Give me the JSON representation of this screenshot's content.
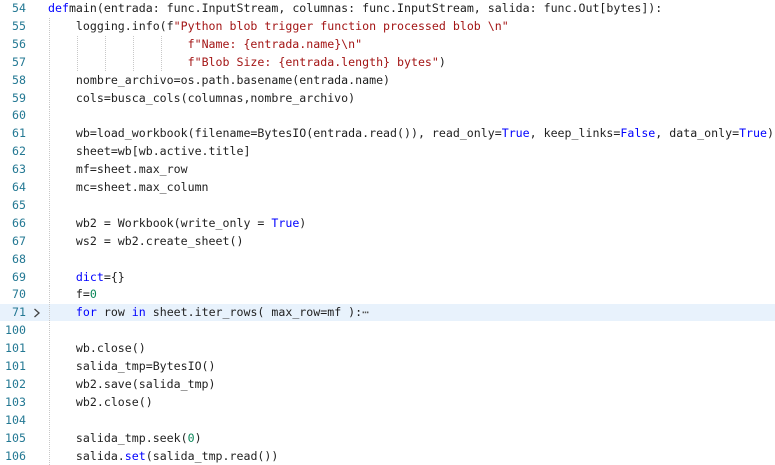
{
  "editor": {
    "lines": [
      {
        "num": "54",
        "indent": 0,
        "tokens": [
          [
            "kw",
            "def"
          ],
          [
            "",
            "main(entrada: func.InputStream, columnas: func.InputStream, salida: func.Out[bytes]):"
          ]
        ]
      },
      {
        "num": "55",
        "indent": 1,
        "tokens": [
          [
            "",
            "logging.info(f"
          ],
          [
            "str",
            "\"Python blob trigger function processed blob \\n\""
          ]
        ]
      },
      {
        "num": "56",
        "indent": 1,
        "extra_guides": 4,
        "tokens": [
          [
            "",
            "                "
          ],
          [
            "str",
            "f\"Name: {entrada.name}\\n\""
          ]
        ]
      },
      {
        "num": "57",
        "indent": 1,
        "extra_guides": 4,
        "tokens": [
          [
            "",
            "                "
          ],
          [
            "str",
            "f\"Blob Size: {entrada.length} bytes\""
          ],
          [
            "",
            ")"
          ]
        ]
      },
      {
        "num": "58",
        "indent": 1,
        "tokens": [
          [
            "",
            "nombre_archivo=os.path.basename(entrada.name)"
          ]
        ]
      },
      {
        "num": "59",
        "indent": 1,
        "tokens": [
          [
            "",
            "cols=busca_cols(columnas,nombre_archivo)"
          ]
        ]
      },
      {
        "num": "60",
        "indent": 1,
        "tokens": []
      },
      {
        "num": "61",
        "indent": 1,
        "tokens": [
          [
            "",
            "wb=load_workbook(filename=BytesIO(entrada.read()), read_only="
          ],
          [
            "kw",
            "True"
          ],
          [
            "",
            ", keep_links="
          ],
          [
            "kw",
            "False"
          ],
          [
            "",
            ", data_only="
          ],
          [
            "kw",
            "True"
          ],
          [
            "",
            ")"
          ]
        ]
      },
      {
        "num": "62",
        "indent": 1,
        "tokens": [
          [
            "",
            "sheet=wb[wb.active.title]"
          ]
        ]
      },
      {
        "num": "63",
        "indent": 1,
        "tokens": [
          [
            "",
            "mf=sheet.max_row"
          ]
        ]
      },
      {
        "num": "64",
        "indent": 1,
        "tokens": [
          [
            "",
            "mc=sheet.max_column"
          ]
        ]
      },
      {
        "num": "65",
        "indent": 1,
        "tokens": []
      },
      {
        "num": "66",
        "indent": 1,
        "tokens": [
          [
            "",
            "wb2 = Workbook(write_only = "
          ],
          [
            "kw",
            "True"
          ],
          [
            "",
            ")"
          ]
        ]
      },
      {
        "num": "67",
        "indent": 1,
        "tokens": [
          [
            "",
            "ws2 = wb2.create_sheet()"
          ]
        ]
      },
      {
        "num": "68",
        "indent": 1,
        "tokens": []
      },
      {
        "num": "69",
        "indent": 1,
        "tokens": [
          [
            "kw",
            "dict"
          ],
          [
            "",
            "={}"
          ]
        ]
      },
      {
        "num": "70",
        "indent": 1,
        "tokens": [
          [
            "",
            "f="
          ],
          [
            "num",
            "0"
          ]
        ]
      },
      {
        "num": "71",
        "indent": 1,
        "folded": true,
        "tokens": [
          [
            "kw",
            "for"
          ],
          [
            "",
            " row "
          ],
          [
            "kw",
            "in"
          ],
          [
            "",
            " sheet.iter_rows( max_row=mf ):"
          ],
          [
            "fold",
            "⋯"
          ]
        ]
      },
      {
        "num": "100",
        "indent": 1,
        "tokens": []
      },
      {
        "num": "101",
        "indent": 1,
        "tokens": [
          [
            "",
            "wb.close()"
          ]
        ]
      },
      {
        "num": "101",
        "indent": 1,
        "tokens": [
          [
            "",
            "salida_tmp=BytesIO()"
          ]
        ]
      },
      {
        "num": "102",
        "indent": 1,
        "tokens": [
          [
            "",
            "wb2.save(salida_tmp)"
          ]
        ]
      },
      {
        "num": "103",
        "indent": 1,
        "tokens": [
          [
            "",
            "wb2.close()"
          ]
        ]
      },
      {
        "num": "104",
        "indent": 1,
        "tokens": []
      },
      {
        "num": "105",
        "indent": 1,
        "tokens": [
          [
            "",
            "salida_tmp.seek("
          ],
          [
            "num",
            "0"
          ],
          [
            "",
            ")"
          ]
        ]
      },
      {
        "num": "106",
        "indent": 1,
        "tokens": [
          [
            "",
            "salida."
          ],
          [
            "kw",
            "set"
          ],
          [
            "",
            "(salida_tmp.read())"
          ]
        ]
      }
    ],
    "fold_icon": "chevron-right-icon",
    "colors": {
      "keyword": "#0000ff",
      "string": "#a31515",
      "number": "#098658",
      "line_number": "#237893",
      "highlight": "#e8f2fc"
    }
  }
}
